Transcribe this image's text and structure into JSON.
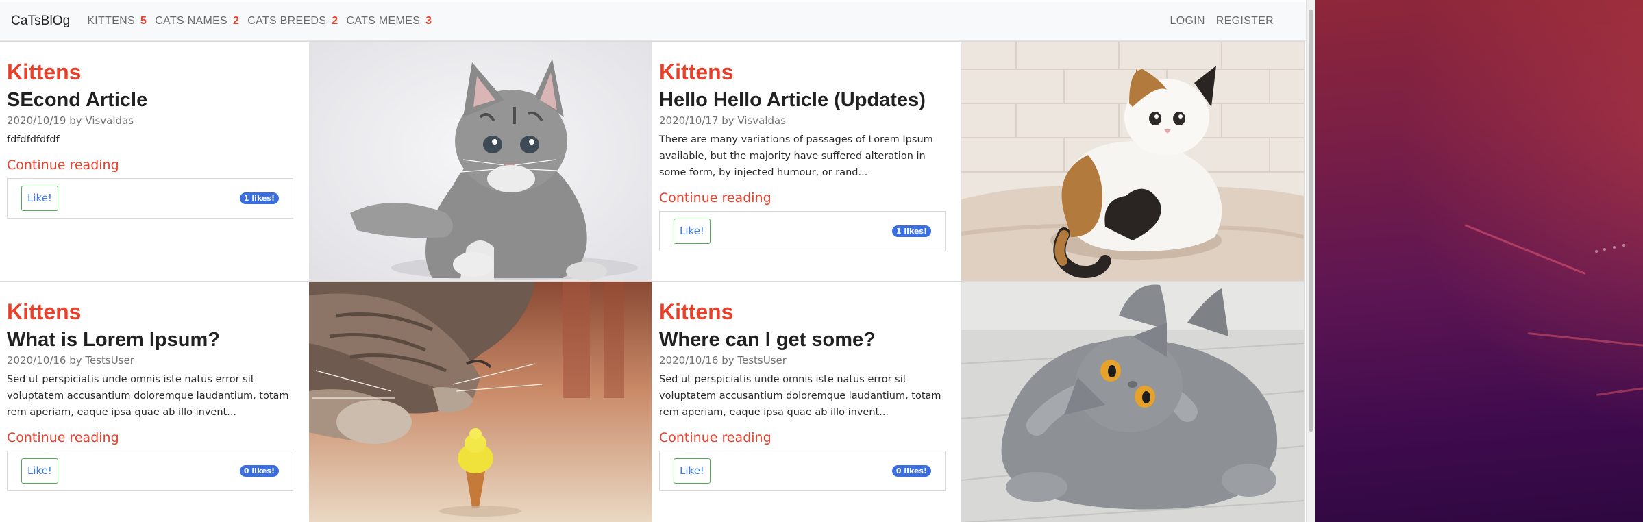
{
  "navbar": {
    "brand": "CaTsBlOg",
    "links": [
      {
        "label": "KITTENS",
        "count": "5"
      },
      {
        "label": "CATS NAMES",
        "count": "2"
      },
      {
        "label": "CATS BREEDS",
        "count": "2"
      },
      {
        "label": "CATS MEMES",
        "count": "3"
      }
    ],
    "login": "LOGIN",
    "register": "REGISTER"
  },
  "posts": [
    {
      "category": "Kittens",
      "title": "SEcond Article",
      "meta": "2020/10/19 by Visvaldas",
      "excerpt": "fdfdfdfdfdf",
      "continue": "Continue reading",
      "like": "Like!",
      "likes": "1 likes!"
    },
    {
      "category": "Kittens",
      "title": "Hello Hello Article (Updates)",
      "meta": "2020/10/17 by Visvaldas",
      "excerpt": "There are many variations of passages of Lorem Ipsum available, but the majority have suffered alteration in some form, by injected humour, or rand...",
      "continue": "Continue reading",
      "like": "Like!",
      "likes": "1 likes!"
    },
    {
      "category": "Kittens",
      "title": "What is Lorem Ipsum?",
      "meta": "2020/10/16 by TestsUser",
      "excerpt": "Sed ut perspiciatis unde omnis iste natus error sit voluptatem accusantium doloremque laudantium, totam rem aperiam, eaque ipsa quae ab illo invent...",
      "continue": "Continue reading",
      "like": "Like!",
      "likes": "0 likes!"
    },
    {
      "category": "Kittens",
      "title": "Where can I get some?",
      "meta": "2020/10/16 by TestsUser",
      "excerpt": "Sed ut perspiciatis unde omnis iste natus error sit voluptatem accusantium doloremque laudantium, totam rem aperiam, eaque ipsa quae ab illo invent...",
      "continue": "Continue reading",
      "like": "Like!",
      "likes": "0 likes!"
    }
  ],
  "colors": {
    "accent": "#e8412b",
    "like_border": "#4caf50",
    "badge": "#3b6fe0"
  }
}
